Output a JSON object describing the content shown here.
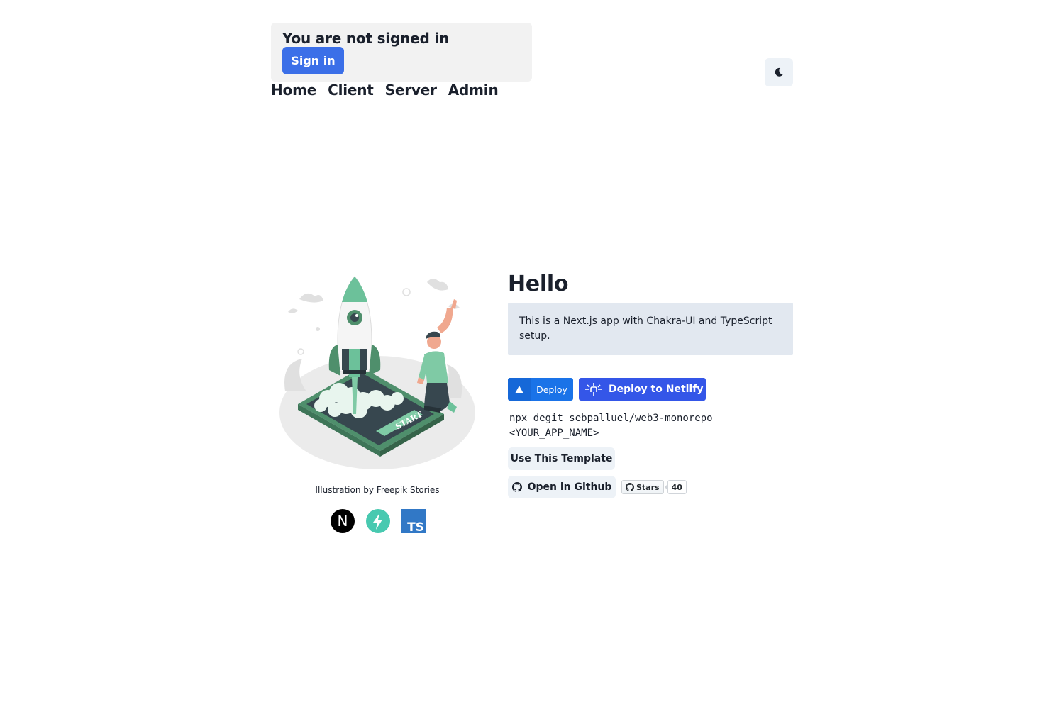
{
  "auth": {
    "status_text": "You are not signed in",
    "sign_in_label": "Sign in"
  },
  "nav": {
    "items": [
      "Home",
      "Client",
      "Server",
      "Admin"
    ]
  },
  "theme_toggle": {
    "icon": "moon-icon"
  },
  "hero": {
    "illustration_text": "START",
    "credit": "Illustration by Freepik Stories",
    "logos": [
      "nextjs-logo",
      "chakra-ui-logo",
      "typescript-logo"
    ],
    "ts_logo_text": "TS",
    "next_logo_text": "N"
  },
  "content": {
    "title": "Hello",
    "description": "This is a Next.js app with Chakra-UI and TypeScript setup.",
    "deploy_vercel_label": "Deploy",
    "deploy_netlify_label": "Deploy to Netlify",
    "command": "npx degit sebpalluel/web3-monorepo <YOUR_APP_NAME>",
    "use_template_label": "Use This Template",
    "open_github_label": "Open in Github",
    "stars_label": "Stars",
    "stars_count": "40"
  },
  "colors": {
    "primary": "#3b6fe8",
    "vercel_blue": "#1a73e8",
    "netlify_blue": "#3456e8",
    "illustration_green": "#6cc19a"
  }
}
